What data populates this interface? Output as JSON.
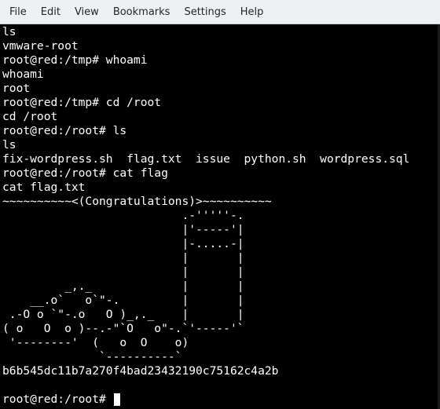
{
  "menubar": {
    "items": [
      "File",
      "Edit",
      "View",
      "Bookmarks",
      "Settings",
      "Help"
    ]
  },
  "terminal": {
    "lines": [
      "ls",
      "vmware-root",
      "root@red:/tmp# whoami",
      "whoami",
      "root",
      "root@red:/tmp# cd /root",
      "cd /root",
      "root@red:/root# ls",
      "ls",
      "fix-wordpress.sh  flag.txt  issue  python.sh  wordpress.sql",
      "root@red:/root# cat flag",
      "cat flag.txt",
      "~~~~~~~~~~<(Congratulations)>~~~~~~~~~~",
      "                          .-'''''-.",
      "                          |'-----'|",
      "                          |-.....-|",
      "                          |       |",
      "                          |       |",
      "         _,._             |       |",
      "    __.o`   o`\"-.         |       |",
      " .-O o `\"-.o   O )_,._    |       |",
      "( o   O  o )--.-\"`O   o\"-.`'-----'`",
      " '--------'  (   o  O    o)",
      "              `----------`",
      "b6b545dc11b7a270f4bad23432190c75162c4a2b",
      ""
    ],
    "prompt": "root@red:/root# "
  },
  "colors": {
    "background": "#000000",
    "foreground": "#ffffff",
    "menubar_bg": "#eff0f1"
  }
}
